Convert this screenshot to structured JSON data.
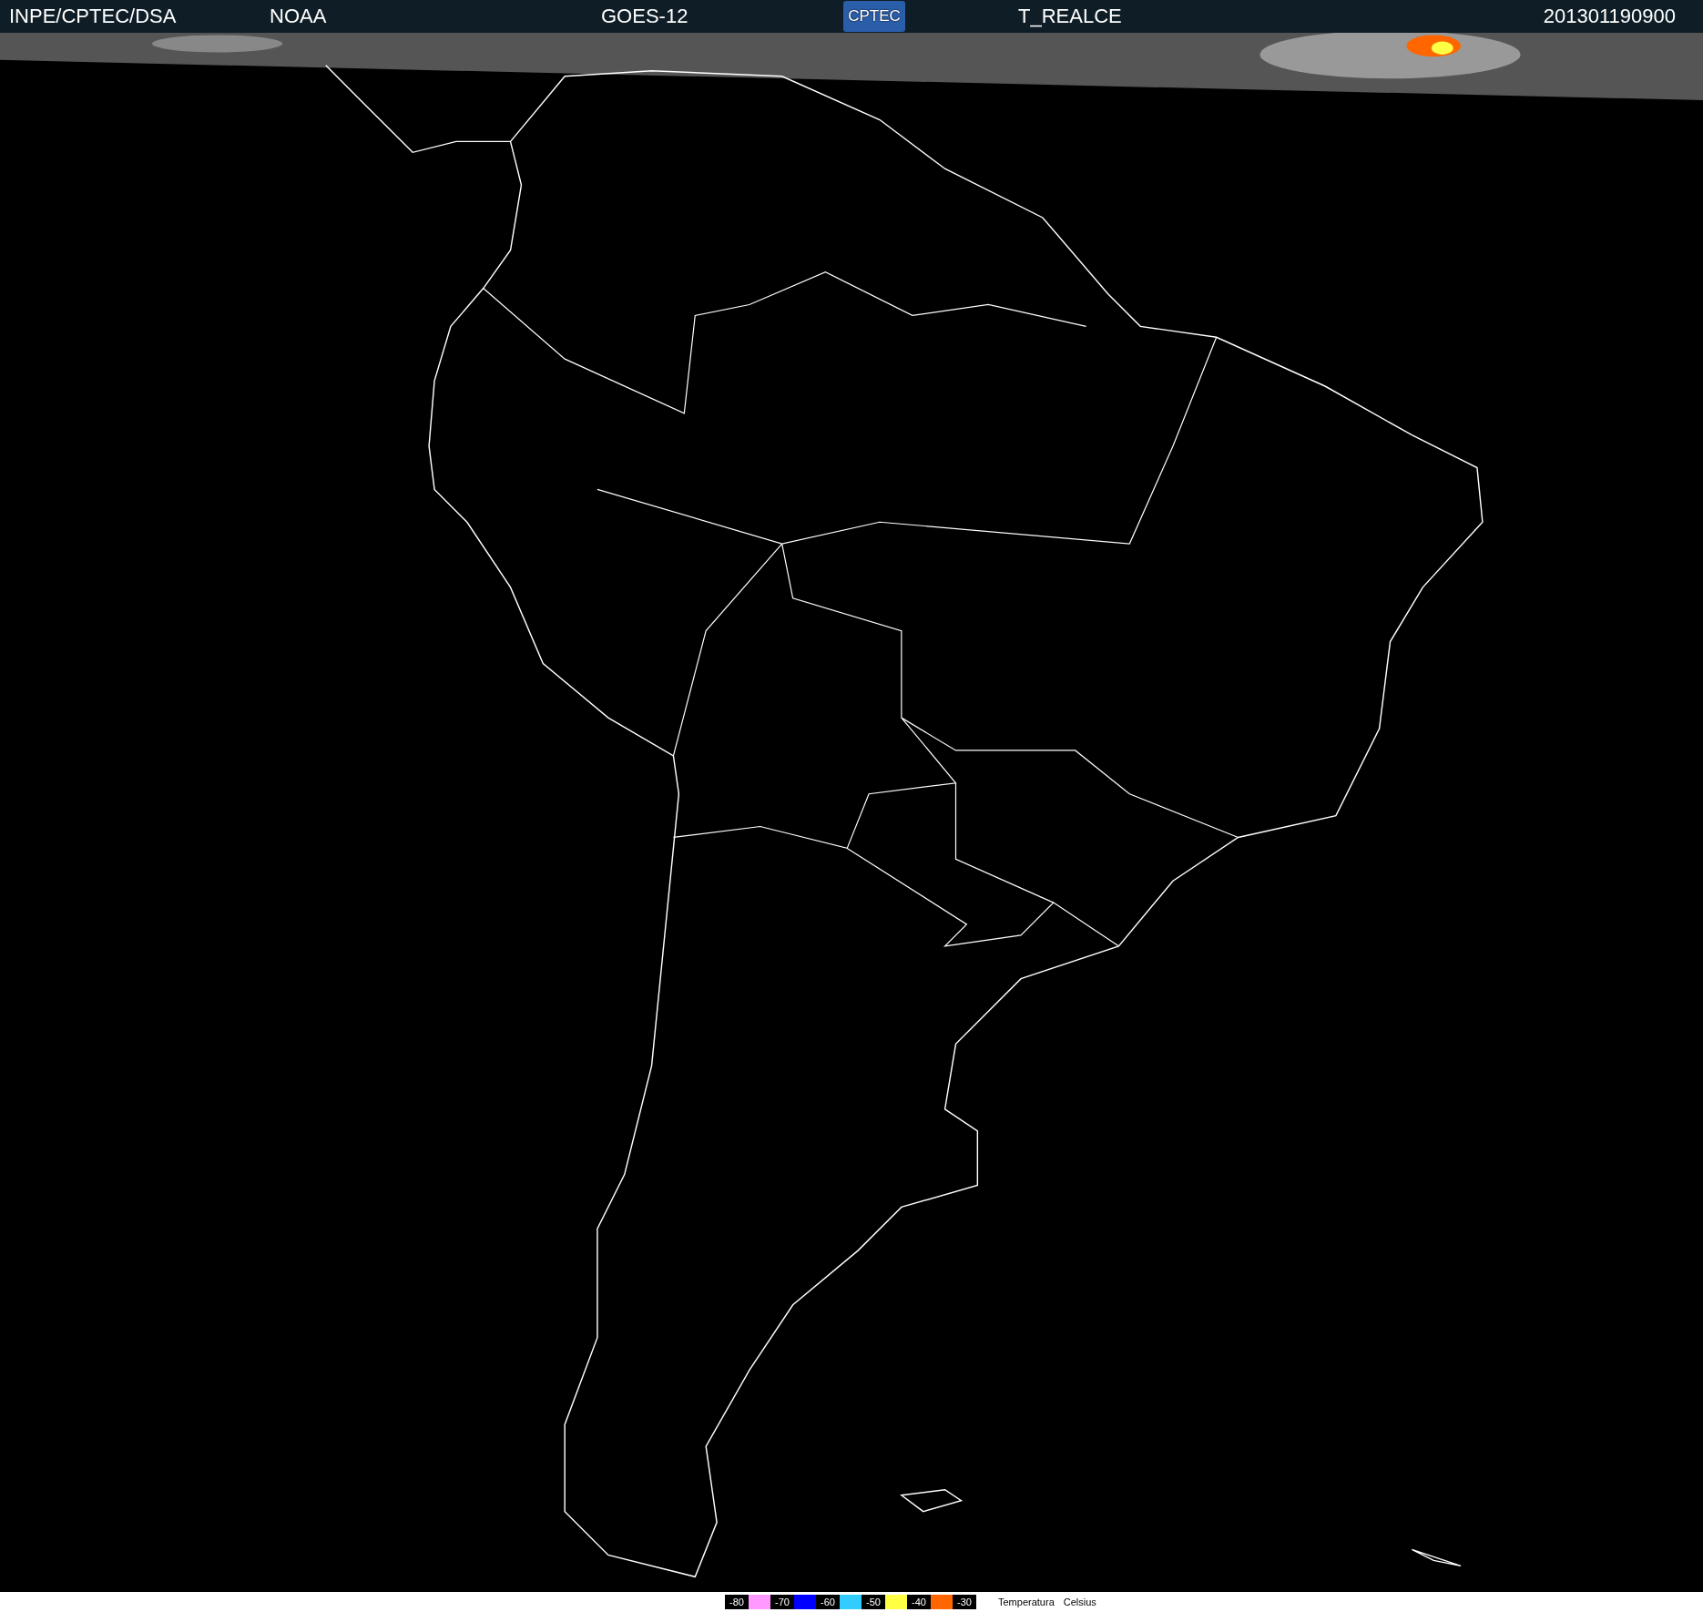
{
  "header": {
    "source": "INPE/CPTEC/DSA",
    "agency": "NOAA",
    "satellite": "GOES-12",
    "logo": "CPTEC",
    "product": "T_REALCE",
    "timestamp": "201301190900"
  },
  "legend": {
    "steps": [
      {
        "label": "-80",
        "color": "#ff99ff"
      },
      {
        "label": "-70",
        "color": "#0000ff"
      },
      {
        "label": "-60",
        "color": "#33ccff"
      },
      {
        "label": "-50",
        "color": "#ffff44"
      },
      {
        "label": "-40",
        "color": "#ff6600"
      },
      {
        "label": "-30"
      }
    ],
    "quantity": "Temperatura",
    "unit": "Celsius"
  }
}
